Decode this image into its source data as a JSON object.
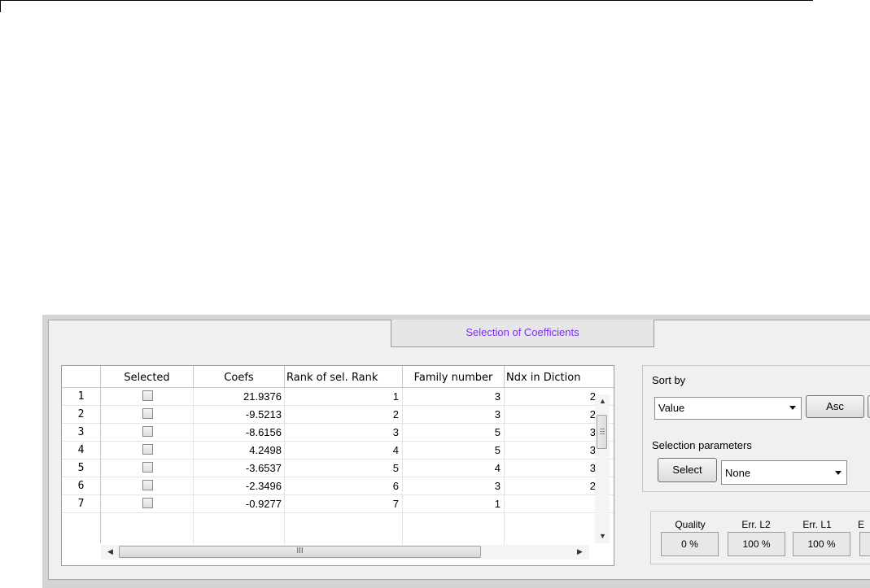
{
  "panel": {
    "title": "Selection of Coefficients"
  },
  "table": {
    "columns": [
      "Selected",
      "Coefs",
      "Rank  of sel.",
      "Rank",
      "Family number",
      "Ndx in Diction"
    ],
    "rows": [
      {
        "n": "1",
        "coef": "21.9376",
        "rank": "1",
        "family": "3",
        "ndx": "2"
      },
      {
        "n": "2",
        "coef": "-9.5213",
        "rank": "2",
        "family": "3",
        "ndx": "2"
      },
      {
        "n": "3",
        "coef": "-8.6156",
        "rank": "3",
        "family": "5",
        "ndx": "3"
      },
      {
        "n": "4",
        "coef": "4.2498",
        "rank": "4",
        "family": "5",
        "ndx": "3"
      },
      {
        "n": "5",
        "coef": "-3.6537",
        "rank": "5",
        "family": "4",
        "ndx": "3"
      },
      {
        "n": "6",
        "coef": "-2.3496",
        "rank": "6",
        "family": "3",
        "ndx": "2"
      },
      {
        "n": "7",
        "coef": "-0.9277",
        "rank": "7",
        "family": "1",
        "ndx": ""
      }
    ],
    "hscroll_grip": "III"
  },
  "sort": {
    "label": "Sort by",
    "value": "Value",
    "asc_label": "Asc"
  },
  "selection": {
    "label": "Selection parameters",
    "select_label": "Select",
    "value": "None"
  },
  "metrics": [
    {
      "label": "Quality",
      "value": "0 %"
    },
    {
      "label": "Err. L2",
      "value": "100 %"
    },
    {
      "label": "Err. L1",
      "value": "100 %"
    },
    {
      "label": "E",
      "value": ""
    }
  ]
}
